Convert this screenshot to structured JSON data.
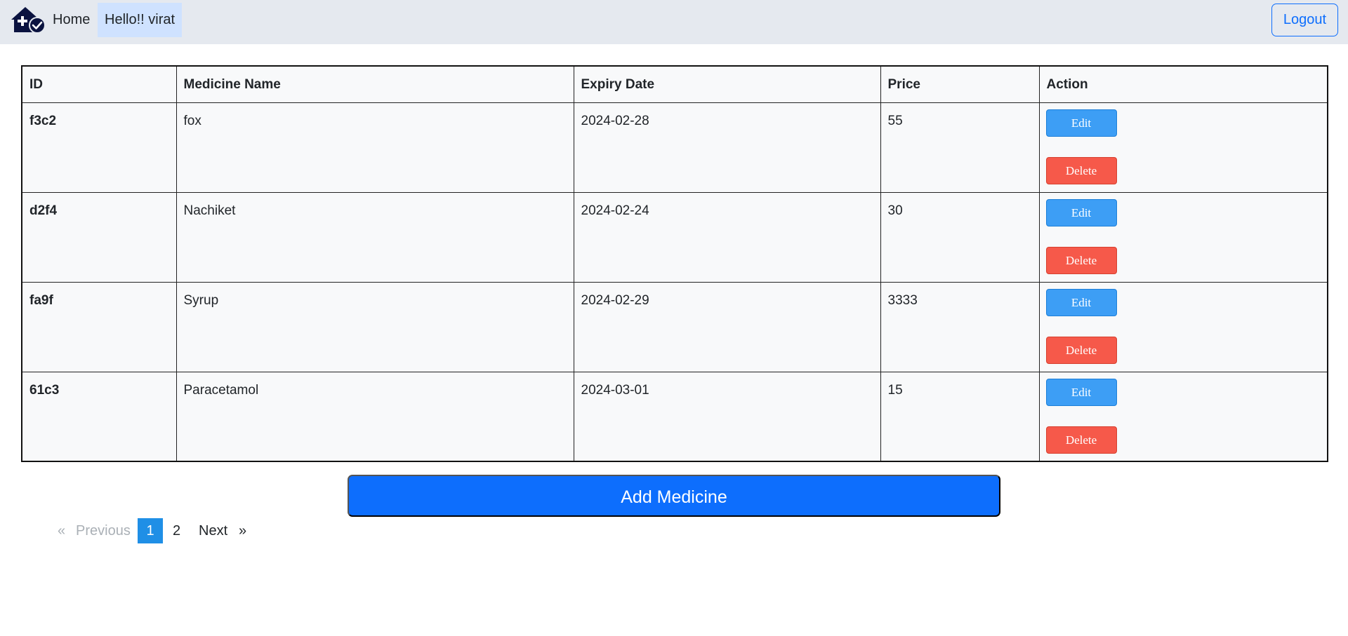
{
  "navbar": {
    "brand_icon": "house-medical-check-icon",
    "home_label": "Home",
    "user_greeting": "Hello!! virat",
    "logout_label": "Logout"
  },
  "table": {
    "headers": [
      "ID",
      "Medicine Name",
      "Expiry Date",
      "Price",
      "Action"
    ],
    "rows": [
      {
        "id": "f3c2",
        "name": "fox",
        "expiry": "2024-02-28",
        "price": "55",
        "edit": "Edit",
        "delete": "Delete"
      },
      {
        "id": "d2f4",
        "name": "Nachiket",
        "expiry": "2024-02-24",
        "price": "30",
        "edit": "Edit",
        "delete": "Delete"
      },
      {
        "id": "fa9f",
        "name": "Syrup",
        "expiry": "2024-02-29",
        "price": "3333",
        "edit": "Edit",
        "delete": "Delete"
      },
      {
        "id": "61c3",
        "name": "Paracetamol",
        "expiry": "2024-03-01",
        "price": "15",
        "edit": "Edit",
        "delete": "Delete"
      }
    ]
  },
  "add_button": "Add Medicine",
  "pagination": {
    "prev_arrow": "«",
    "prev_label": "Previous",
    "pages": [
      "1",
      "2"
    ],
    "active_page": "1",
    "next_label": "Next",
    "next_arrow": "»"
  },
  "colors": {
    "navbar_bg": "#e5e9ef",
    "primary": "#0d6efd",
    "edit": "#3d9ef5",
    "delete": "#f6594a",
    "active_page": "#1f8fe6"
  }
}
